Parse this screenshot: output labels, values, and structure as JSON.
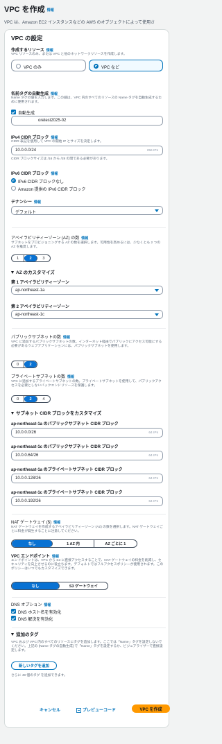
{
  "header": {
    "title": "VPC を作成",
    "info": "情報",
    "description": "VPC は、Amazon EC2 インスタンスなどの AWS のオブジェクトによって使用さ"
  },
  "vpc_settings": {
    "title": "VPC の設定",
    "resources": {
      "label": "作成するリソース",
      "info": "情報",
      "description": "VPC リソースのみ、または VPC と他のネットワークリソースを作成します。",
      "options": [
        "VPC のみ",
        "VPC など"
      ],
      "selected": "VPC など"
    },
    "name_tag": {
      "label": "名前タグの自動生成",
      "info": "情報",
      "description": "Name タグの値を入力します。この値は、VPC 内のすべてのリソースの Name タグを自動生成するために使用されます。",
      "auto_generate_label": "自動生成",
      "value": "oretest2025-02"
    },
    "ipv4": {
      "label": "IPv4 CIDR ブロック",
      "info": "情報",
      "description": "CIDR 表記を使用して VPC の開始 IP とサイズを決定します。",
      "value": "10.0.0.0/24",
      "suffix": "256 IPs",
      "hint": "CIDR ブロックサイズは /16 から /28 の間である必要があります。"
    },
    "ipv6": {
      "label": "IPv6 CIDR ブロック",
      "info": "情報",
      "options": [
        "IPv6 CIDR ブロックなし",
        "Amazon 提供の IPv6 CIDR ブロック"
      ],
      "selected": "IPv6 CIDR ブロックなし"
    },
    "tenancy": {
      "label": "テナンシー",
      "info": "情報",
      "value": "デフォルト"
    },
    "az_count": {
      "label": "アベイラビリティーゾーン (AZ) の数",
      "info": "情報",
      "description": "サブネットをプロビジョニングする AZ の数を選択します。可用性を高めるには、少なくとも 2 つの AZ を推奨します。",
      "options": [
        "1",
        "2",
        "3"
      ],
      "selected": "2"
    },
    "az_custom": {
      "title": "AZ のカスタマイズ",
      "az1_label": "第 1 アベイラビリティーゾーン",
      "az1_value": "ap-northeast-1a",
      "az2_label": "第 2 アベイラビリティーゾーン",
      "az2_value": "ap-northeast-1c"
    },
    "public_subnets": {
      "label": "パブリックサブネットの数",
      "info": "情報",
      "description": "VPC に追加するパブリックサブネットの数。インターネット経由でパブリックにアクセス可能にする必要があるウェブアプリケーションには、パブリックサブネットを使用します。",
      "options": [
        "0",
        "2"
      ],
      "selected": "2"
    },
    "private_subnets": {
      "label": "プライベートサブネットの数",
      "info": "情報",
      "description": "VPC に追加するプライベートサブネットの数。プライベートサブネットを使用して、パブリックアクセスを必要としないバックエンドリソースを保護します。",
      "options": [
        "0",
        "2",
        "4"
      ],
      "selected": "2"
    },
    "subnet_cidr": {
      "title": "サブネット CIDR ブロックをカスタマイズ",
      "items": [
        {
          "label": "ap-northeast-1a のパブリックサブネット CIDR ブロック",
          "value": "10.0.0.0/26",
          "suffix": "64 IPs"
        },
        {
          "label": "ap-northeast-1c のパブリックサブネット CIDR ブロック",
          "value": "10.0.0.64/26",
          "suffix": "64 IPs"
        },
        {
          "label": "ap-northeast-1a のプライベートサブネット CIDR ブロック",
          "value": "10.0.0.128/26",
          "suffix": "64 IPs"
        },
        {
          "label": "ap-northeast-1c のプライベートサブネット CIDR ブロック",
          "value": "10.0.0.192/26",
          "suffix": "64 IPs"
        }
      ]
    },
    "nat": {
      "label": "NAT ゲートウェイ ($)",
      "info": "情報",
      "description": "NAT ゲートウェイを作成するアベイラビリティーゾーン (AZ) の数を選択します。NAT ゲートウェイごとに料金が発生することに注意してください。",
      "options": [
        "なし",
        "1 AZ 内",
        "AZ ごとに 1"
      ],
      "selected": "なし"
    },
    "endpoint": {
      "label": "VPC エンドポイント",
      "info": "情報",
      "description": "エンドポイントは、VPC から S3 に直接アクセスすることで、NAT ゲートウェイの料金を削減し、セキュリティを向上させるのに役立ちます。デフォルトではフルアクセスポリシーが使用されます。このポリシーはいつでもカスタマイズできます。",
      "options": [
        "なし",
        "S3 ゲートウェイ"
      ],
      "selected": "なし"
    },
    "dns": {
      "label": "DNS オプション",
      "info": "情報",
      "hostnames": "DNS ホスト名を有効化",
      "resolution": "DNS 解決を有効化"
    },
    "tags": {
      "title": "追加のタグ",
      "description": "VPC および VPC 内のすべてのリソースにタグを追加します。ここでは「Name」タグを設定しないでください。上記の [Name タグの自動生成] で「Name」タグを設定するか、ビジュアライザーで直接設定します。",
      "add_button": "新しいタグを追加",
      "remaining": "さらに 49 個のタグ を追加できます。"
    }
  },
  "footer": {
    "cancel": "キャンセル",
    "preview_code": "プレビューコード",
    "create": "VPC を作成"
  }
}
